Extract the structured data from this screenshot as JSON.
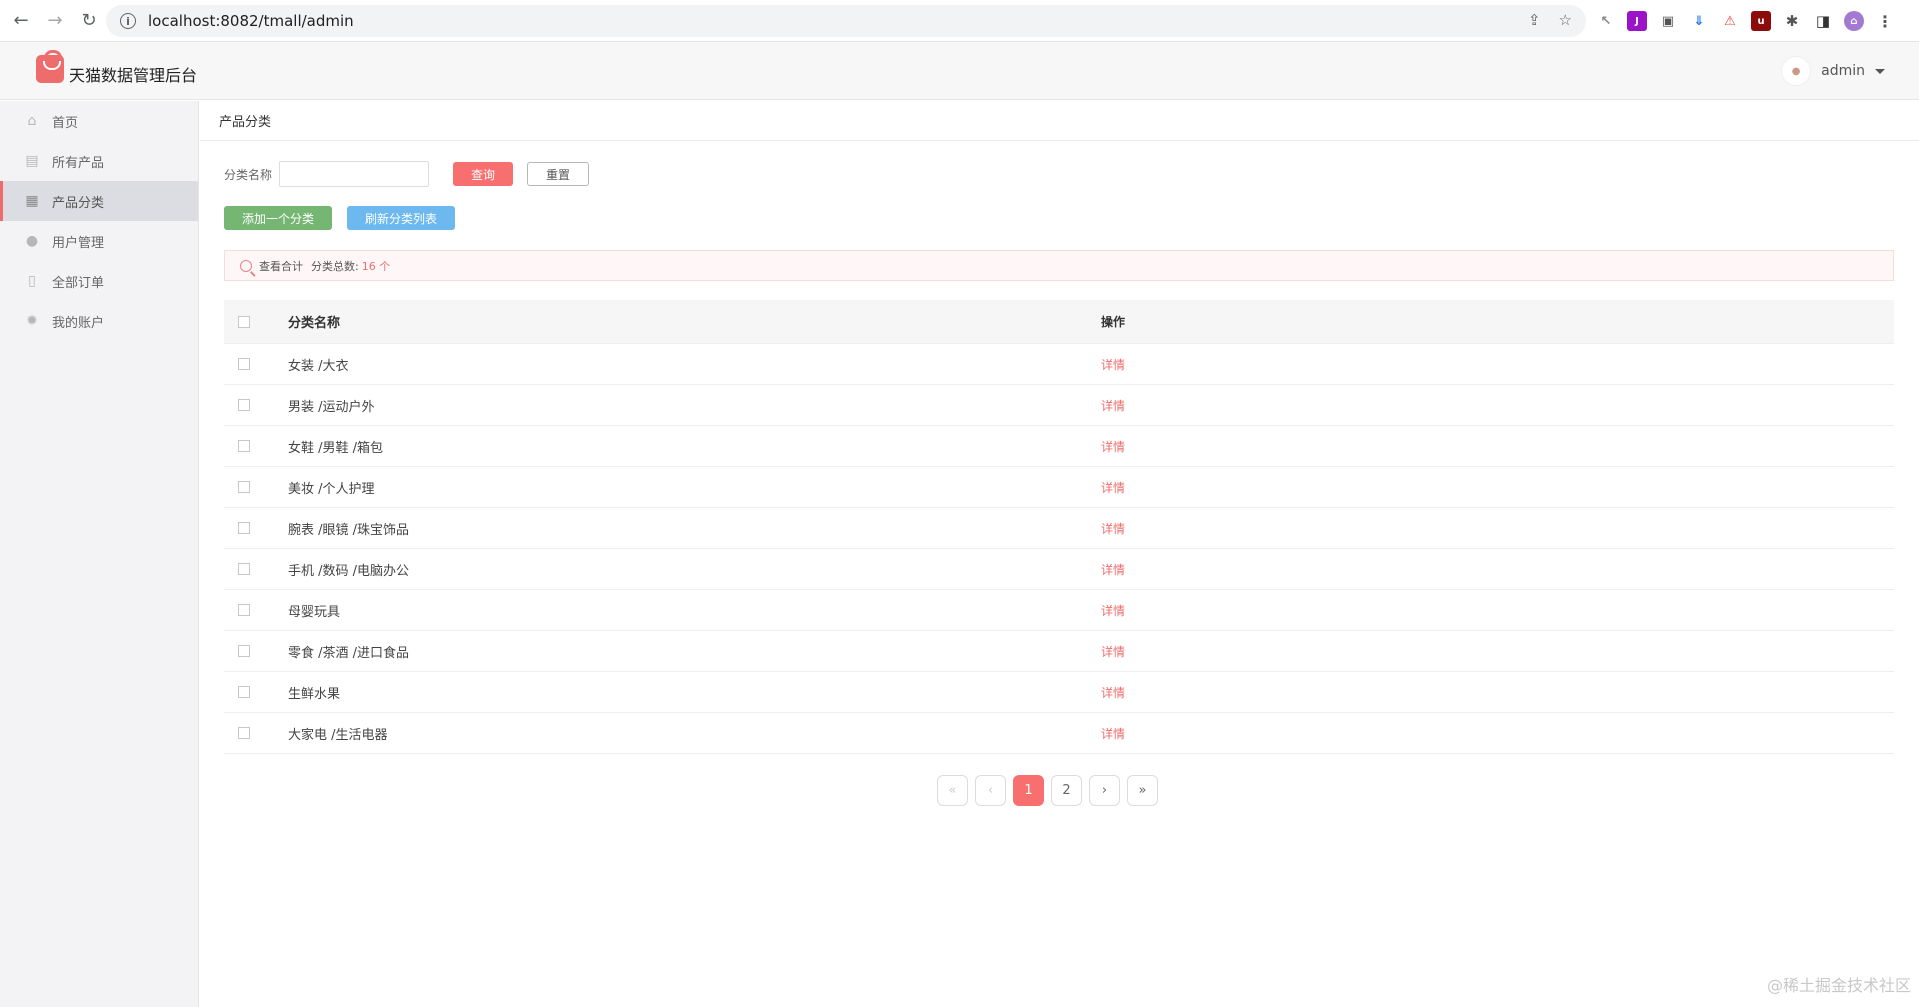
{
  "browser": {
    "url": "localhost:8082/tmall/admin"
  },
  "header": {
    "title": "天猫数据管理后台",
    "user": "admin"
  },
  "sidebar": {
    "items": [
      {
        "label": "首页",
        "icon": "home-icon"
      },
      {
        "label": "所有产品",
        "icon": "image-icon"
      },
      {
        "label": "产品分类",
        "icon": "grid-icon",
        "active": true
      },
      {
        "label": "用户管理",
        "icon": "user-icon"
      },
      {
        "label": "全部订单",
        "icon": "document-icon"
      },
      {
        "label": "我的账户",
        "icon": "gear-icon"
      }
    ]
  },
  "page": {
    "title": "产品分类",
    "search_label": "分类名称",
    "query_button": "查询",
    "reset_button": "重置",
    "add_button": "添加一个分类",
    "refresh_button": "刷新分类列表",
    "summary_label": "查看合计",
    "summary_total_label": "分类总数:",
    "summary_count": "16 个"
  },
  "table": {
    "headers": [
      "分类名称",
      "操作"
    ],
    "rows": [
      {
        "name": "女装 /大衣",
        "action": "详情"
      },
      {
        "name": "男装 /运动户外",
        "action": "详情"
      },
      {
        "name": "女鞋 /男鞋 /箱包",
        "action": "详情"
      },
      {
        "name": "美妆 /个人护理",
        "action": "详情"
      },
      {
        "name": "腕表 /眼镜 /珠宝饰品",
        "action": "详情"
      },
      {
        "name": "手机 /数码 /电脑办公",
        "action": "详情"
      },
      {
        "name": "母婴玩具",
        "action": "详情"
      },
      {
        "name": "零食 /茶酒 /进口食品",
        "action": "详情"
      },
      {
        "name": "生鲜水果",
        "action": "详情"
      },
      {
        "name": "大家电 /生活电器",
        "action": "详情"
      }
    ]
  },
  "pagination": {
    "first": "«",
    "prev": "‹",
    "pages": [
      "1",
      "2"
    ],
    "next": "›",
    "last": "»",
    "current": "1"
  },
  "watermark": "@稀土掘金技术社区",
  "colors": {
    "accent": "#f76f6f",
    "green": "#76b673",
    "blue": "#6cb8ef"
  }
}
